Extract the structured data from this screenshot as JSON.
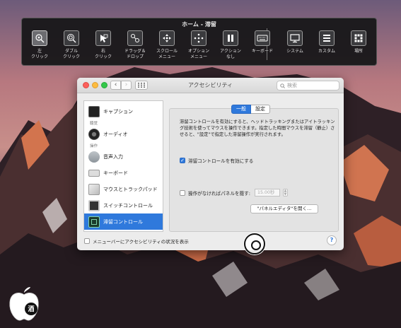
{
  "dwell_panel": {
    "title": "ホーム - 滞留",
    "buttons": [
      {
        "label": "左\nクリック",
        "icon": "left-click-icon",
        "active": true
      },
      {
        "label": "ダブル\nクリック",
        "icon": "double-click-icon"
      },
      {
        "label": "右\nクリック",
        "icon": "right-click-icon"
      },
      {
        "label": "ドラッグ＆\nドロップ",
        "icon": "drag-drop-icon"
      },
      {
        "label": "スクロール\nメニュー",
        "icon": "scroll-menu-icon"
      },
      {
        "label": "オプション\nメニュー",
        "icon": "options-menu-icon"
      },
      {
        "label": "アクション\nなし",
        "icon": "pause-icon"
      },
      {
        "label": "キーボード",
        "icon": "keyboard-icon"
      },
      {
        "label": "システム",
        "icon": "display-icon"
      },
      {
        "label": "カスタム",
        "icon": "list-icon"
      },
      {
        "label": "場所",
        "icon": "grid-icon"
      }
    ]
  },
  "window": {
    "title": "アクセシビリティ",
    "search_placeholder": "検索"
  },
  "sidebar": {
    "items": [
      {
        "label": "キャプション",
        "icon": "captions-icon"
      },
      {
        "label": "オーディオ",
        "icon": "speaker-icon"
      },
      {
        "label": "音声入力",
        "icon": "microphone-icon"
      },
      {
        "label": "キーボード",
        "icon": "keyboard-icon"
      },
      {
        "label": "マウスとトラックパッド",
        "icon": "mouse-icon"
      },
      {
        "label": "スイッチコントロール",
        "icon": "switch-control-icon"
      },
      {
        "label": "滞留コントロール",
        "icon": "dwell-control-icon",
        "selected": true
      }
    ],
    "headers": {
      "hearing": "聴覚",
      "interaction": "操作"
    }
  },
  "content": {
    "tabs": [
      {
        "label": "一般",
        "selected": true
      },
      {
        "label": "設定"
      }
    ],
    "description": "滞留コントロールを有効にすると、ヘッドトラッキングまたはアイトラッキング技術を使ってマウスを操作できます。指定した時間マウスを滞留（静止）させると、\"設定\"で指定した滞留操作が実行されます。",
    "enable_label": "滞留コントロールを有効にする",
    "enable_checked": true,
    "hide_panel_label": "操作がなければパネルを隠す:",
    "hide_panel_checked": false,
    "hide_panel_value": "15.00秒",
    "panel_editor_label": "\"パネルエディタ\"を開く…"
  },
  "footer": {
    "show_status_label": "メニューバーにアクセシビリティの状況を表示",
    "help_label": "?"
  },
  "logo": {
    "text": "酒"
  },
  "colors": {
    "accent": "#2f79dc",
    "panel_bg": "#161618"
  }
}
